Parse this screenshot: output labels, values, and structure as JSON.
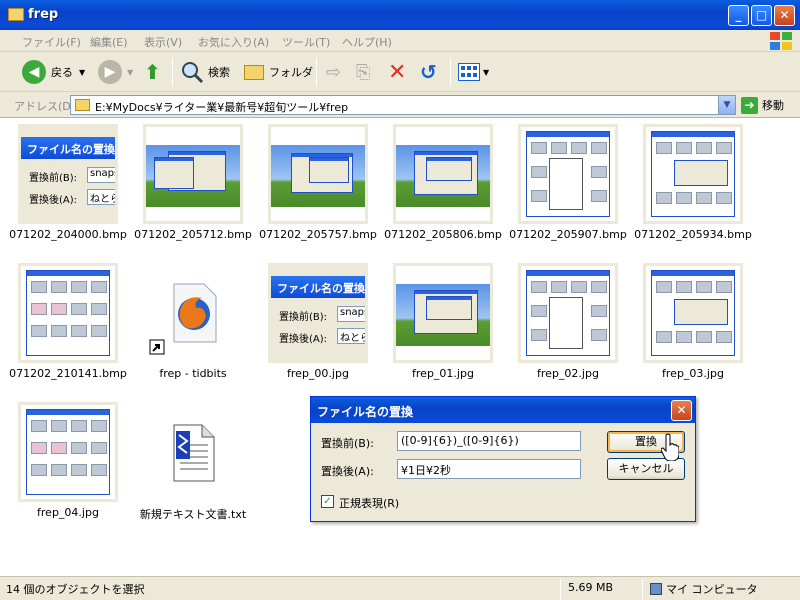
{
  "window": {
    "title": "frep"
  },
  "menu": {
    "items": [
      "ファイル(F)",
      "編集(E)",
      "表示(V)",
      "お気に入り(A)",
      "ツール(T)",
      "ヘルプ(H)"
    ]
  },
  "toolbar": {
    "back_label": "戻る",
    "search_label": "検索",
    "folders_label": "フォルダ"
  },
  "address": {
    "label": "アドレス(D)",
    "path": "E:¥MyDocs¥ライター業¥最新号¥超旬ツール¥frep",
    "go_label": "移動"
  },
  "files": [
    {
      "name": "071202_204000.bmp"
    },
    {
      "name": "071202_205712.bmp"
    },
    {
      "name": "071202_205757.bmp"
    },
    {
      "name": "071202_205806.bmp"
    },
    {
      "name": "071202_205907.bmp"
    },
    {
      "name": "071202_205934.bmp"
    },
    {
      "name": "071202_210141.bmp"
    },
    {
      "name": "frep - tidbits"
    },
    {
      "name": "frep_00.jpg"
    },
    {
      "name": "frep_01.jpg"
    },
    {
      "name": "frep_02.jpg"
    },
    {
      "name": "frep_03.jpg"
    },
    {
      "name": "frep_04.jpg"
    },
    {
      "name": "新規テキスト文書.txt"
    }
  ],
  "thumb_dialog": {
    "title": "ファイル名の置換",
    "before_label": "置換前(B):",
    "after_label": "置換後(A):",
    "before_value": "snapsh",
    "after_value": "ねとら"
  },
  "dialog": {
    "title": "ファイル名の置換",
    "before_label": "置換前(B):",
    "before_value": "([0-9]{6})_([0-9]{6})",
    "after_label": "置換後(A):",
    "after_value": "¥1日¥2秒",
    "replace_button": "置換",
    "cancel_button": "キャンセル",
    "regex_label": "正規表現(R)",
    "regex_checked": true
  },
  "status": {
    "selection": "14 個のオブジェクトを選択",
    "size": "5.69 MB",
    "location": "マイ コンピュータ"
  },
  "colors": {
    "xp_blue": "#0842c8",
    "window_face": "#ece9d8"
  }
}
